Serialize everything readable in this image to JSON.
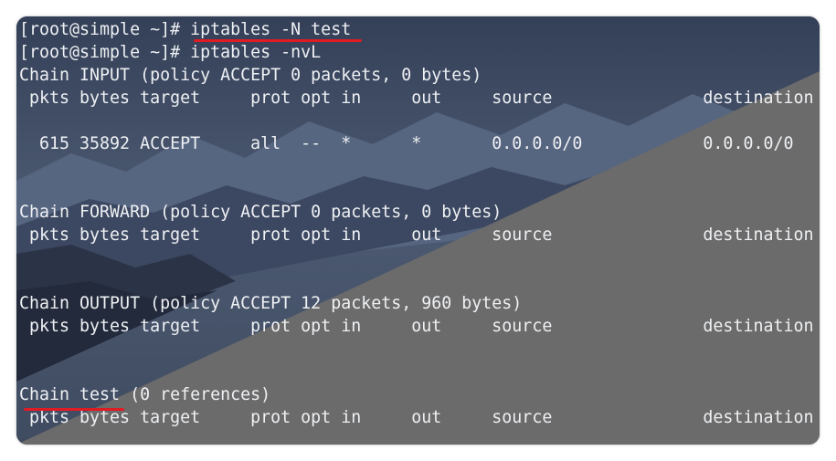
{
  "terminal": {
    "lines": [
      "[root@simple ~]# iptables -N test",
      "[root@simple ~]# iptables -nvL",
      "Chain INPUT (policy ACCEPT 0 packets, 0 bytes)",
      " pkts bytes target     prot opt in     out     source               destination",
      "",
      "  615 35892 ACCEPT     all  --  *      *       0.0.0.0/0            0.0.0.0/0",
      "",
      "",
      "Chain FORWARD (policy ACCEPT 0 packets, 0 bytes)",
      " pkts bytes target     prot opt in     out     source               destination",
      "",
      "",
      "Chain OUTPUT (policy ACCEPT 12 packets, 960 bytes)",
      " pkts bytes target     prot opt in     out     source               destination",
      "",
      "",
      "Chain test (0 references)",
      " pkts bytes target     prot opt in     out     source               destination"
    ]
  },
  "colors": {
    "text": "#eef0f3",
    "annotation": "#e01b24",
    "sky": "#3a475e",
    "gray_overlay": "#6b6b6b"
  }
}
